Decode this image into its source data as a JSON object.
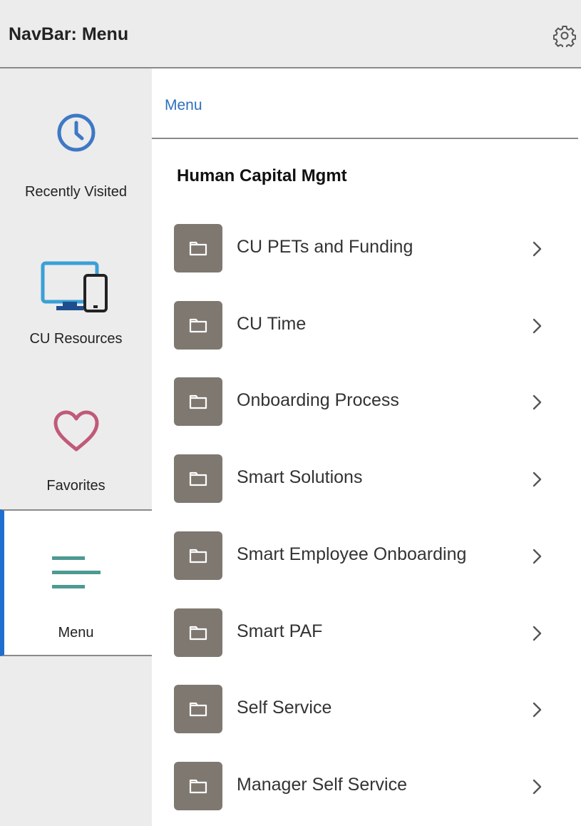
{
  "header": {
    "title": "NavBar: Menu",
    "settings_icon": "gear-icon"
  },
  "sidebar": {
    "items": [
      {
        "label": "Recently Visited",
        "icon": "clock-icon"
      },
      {
        "label": "CU Resources",
        "icon": "desktop-mobile-icon"
      },
      {
        "label": "Favorites",
        "icon": "heart-icon"
      },
      {
        "label": "Menu",
        "icon": "hamburger-menu-icon",
        "active": true
      }
    ]
  },
  "main": {
    "breadcrumb": "Menu",
    "section_heading": "Human Capital Mgmt",
    "items": [
      {
        "label": "CU PETs and Funding"
      },
      {
        "label": "CU Time"
      },
      {
        "label": "Onboarding Process"
      },
      {
        "label": "Smart Solutions"
      },
      {
        "label": "Smart Employee Onboarding"
      },
      {
        "label": "Smart PAF"
      },
      {
        "label": "Self Service"
      },
      {
        "label": "Manager Self Service"
      }
    ]
  },
  "colors": {
    "header_bg": "#ececec",
    "sidebar_bg": "#ececec",
    "active_indicator": "#1f6ecf",
    "link": "#2f6fbf",
    "clock_icon": "#3f78c5",
    "devices_icon": "#3aa0d6",
    "heart_icon": "#c05a78",
    "menu_icon": "#4d9a92",
    "folder_tile": "#7e7870"
  }
}
